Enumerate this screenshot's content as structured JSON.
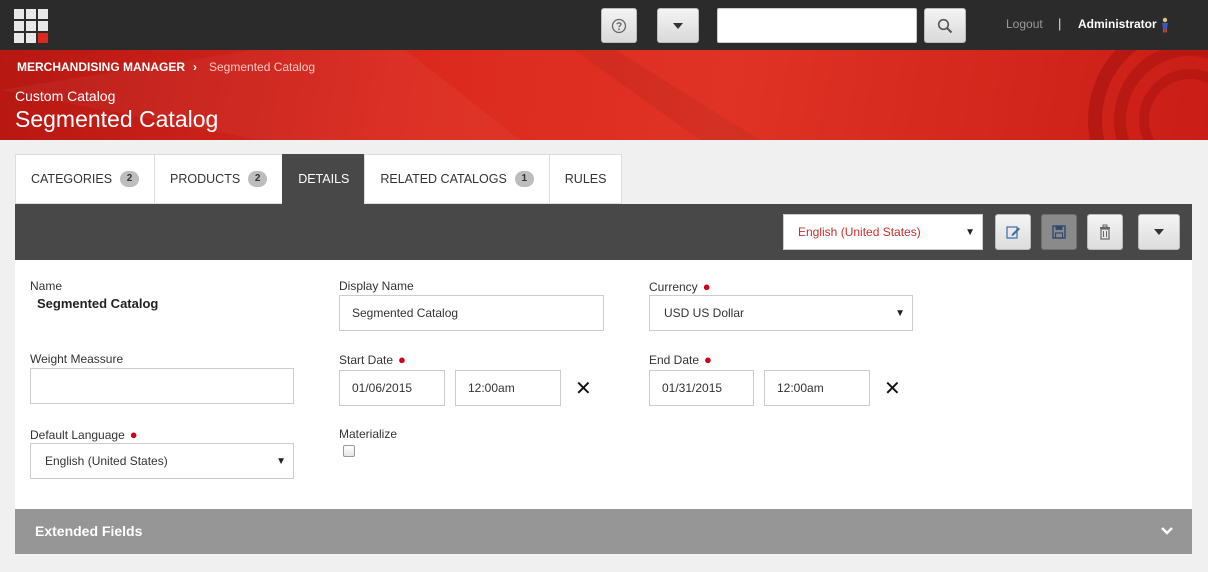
{
  "topbar": {
    "help_icon": "question-circle-icon",
    "menu_icon": "caret-down-icon",
    "search": {
      "value": "",
      "placeholder": ""
    },
    "search_icon": "magnifier-icon",
    "logout_label": "Logout",
    "separator": "|",
    "user_label": "Administrator",
    "user_icon": "person-icon"
  },
  "header": {
    "breadcrumb_root": "MERCHANDISING MANAGER",
    "breadcrumb_arrow": "›",
    "breadcrumb_current": "Segmented Catalog",
    "subtitle": "Custom Catalog",
    "title": "Segmented Catalog"
  },
  "tabs": [
    {
      "label": "CATEGORIES",
      "badge": "2"
    },
    {
      "label": "PRODUCTS",
      "badge": "2"
    },
    {
      "label": "DETAILS",
      "badge": ""
    },
    {
      "label": "RELATED CATALOGS",
      "badge": "1"
    },
    {
      "label": "RULES",
      "badge": ""
    }
  ],
  "toolbar": {
    "language_value": "English (United States)",
    "caret": "▼"
  },
  "form": {
    "name_label": "Name",
    "name_value": "Segmented Catalog",
    "display_name_label": "Display Name",
    "display_name_value": "Segmented Catalog",
    "currency_label": "Currency",
    "currency_value": "USD US Dollar",
    "weight_label": "Weight Meassure",
    "weight_value": "",
    "start_date_label": "Start Date",
    "start_date_value": "01/06/2015",
    "start_time_value": "12:00am",
    "end_date_label": "End Date",
    "end_date_value": "01/31/2015",
    "end_time_value": "12:00am",
    "clear_symbol": "✕",
    "default_language_label": "Default Language",
    "default_language_value": "English (United States)",
    "materialize_label": "Materialize",
    "required_mark": "●"
  },
  "extended": {
    "title": "Extended Fields",
    "chevron_icon": "chevron-down-icon"
  },
  "colors": {
    "brand_red": "#dc291e",
    "topbar_bg": "#2b2b2b",
    "toolbar_bg": "#484848",
    "required": "#d0021b"
  }
}
